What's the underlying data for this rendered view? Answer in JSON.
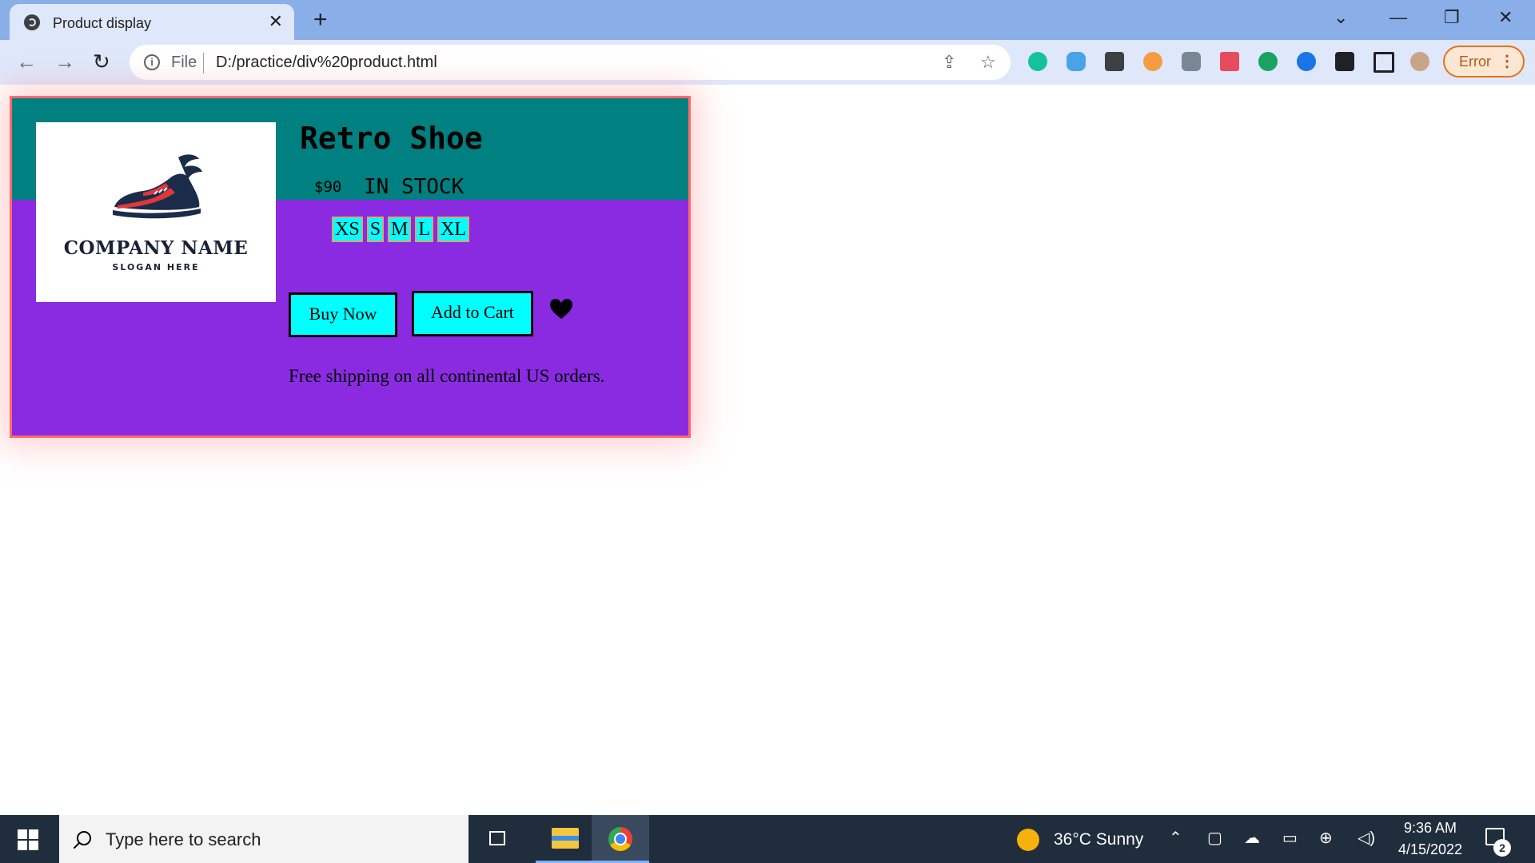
{
  "browser": {
    "tab_title": "Product display",
    "tab_close": "✕",
    "new_tab": "+",
    "url_scheme": "File",
    "url": "D:/practice/div%20product.html",
    "profile_button": "Error",
    "window_controls": {
      "dropdown": "⌄",
      "minimize": "—",
      "restore": "❐",
      "close": "✕"
    },
    "nav": {
      "back": "←",
      "forward": "→",
      "reload": "↻"
    }
  },
  "product": {
    "image": {
      "company_name": "COMPANY NAME",
      "slogan": "SLOGAN HERE"
    },
    "title": "Retro Shoe",
    "price": "$90",
    "stock": "IN STOCK",
    "sizes": [
      "XS",
      "S",
      "M",
      "L",
      "XL"
    ],
    "buy_button": "Buy Now",
    "cart_button": "Add to Cart",
    "shipping": "Free shipping on all continental US orders."
  },
  "taskbar": {
    "search_placeholder": "Type here to search",
    "weather": "36°C  Sunny",
    "time": "9:36 AM",
    "date": "4/15/2022",
    "notification_count": "2"
  },
  "colors": {
    "card_top": "#008080",
    "card_bottom": "#8a2be2",
    "card_border": "#ff6b6b",
    "button_bg": "#00ffff",
    "tab_strip": "#8aaee8",
    "taskbar": "#1f2d3d"
  }
}
